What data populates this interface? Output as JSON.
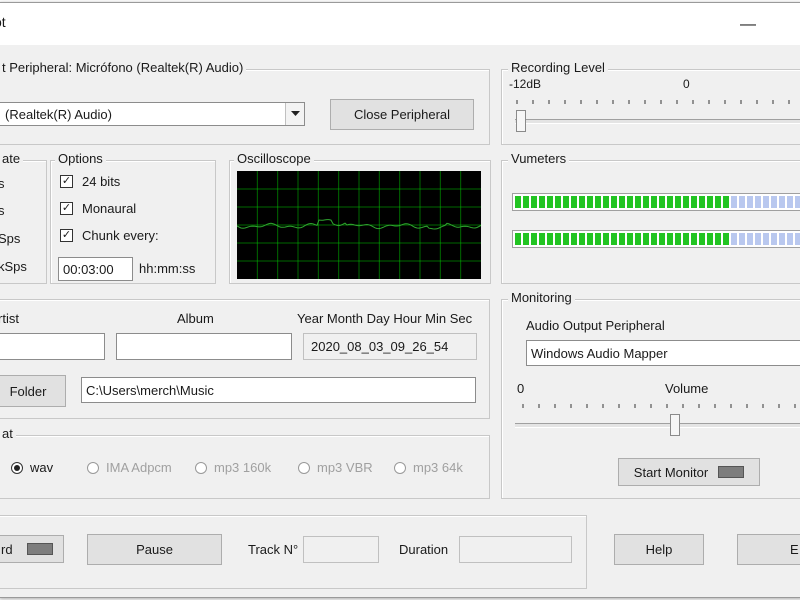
{
  "window": {
    "title_fragment": "ot",
    "minimize_glyph": "—"
  },
  "input_group": {
    "label": "t Peripheral: Micrófono (Realtek(R) Audio)",
    "device_value": "(Realtek(R) Audio)",
    "close_button": "Close Peripheral"
  },
  "rate_group": {
    "label": "ate",
    "items": [
      "s",
      "s",
      "Sps",
      "kSps"
    ]
  },
  "options_group": {
    "label": "Options",
    "bits24": {
      "label": "24 bits",
      "checked": true
    },
    "monaural": {
      "label": "Monaural",
      "checked": true
    },
    "chunk": {
      "label": "Chunk every:",
      "checked": true
    },
    "chunk_value": "00:03:00",
    "chunk_unit": "hh:mm:ss"
  },
  "oscilloscope": {
    "label": "Oscilloscope",
    "grid_color": "#00c000",
    "trace_color": "#2fa52f"
  },
  "tags": {
    "artist_label": "rtist",
    "artist_value": "",
    "album_label": "Album",
    "album_value": "",
    "date_label": "Year Month Day Hour Min Sec",
    "date_value": "2020_08_03_09_26_54"
  },
  "folder": {
    "button": "Folder",
    "path": "C:\\Users\\merch\\Music"
  },
  "format_group": {
    "label": "at",
    "options": [
      {
        "label": "wav",
        "selected": true,
        "enabled": true
      },
      {
        "label": "IMA Adpcm",
        "selected": false,
        "enabled": false
      },
      {
        "label": "mp3 160k",
        "selected": false,
        "enabled": false
      },
      {
        "label": "mp3 VBR",
        "selected": false,
        "enabled": false
      },
      {
        "label": "mp3 64k",
        "selected": false,
        "enabled": false
      }
    ]
  },
  "recording_level": {
    "label": "Recording Level",
    "left_mark": "-12dB",
    "center_mark": "0",
    "level": 0.0
  },
  "vumeters": {
    "label": "Vumeters",
    "channels": [
      {
        "level": 0.72
      },
      {
        "level": 0.72
      }
    ],
    "on_color": "#22c422",
    "off_color": "#b9c8ef"
  },
  "monitoring": {
    "label": "Monitoring",
    "output_label": "Audio Output Peripheral",
    "output_value": "Windows Audio Mapper",
    "min_mark": "0",
    "volume_label": "Volume",
    "volume": 0.55,
    "start_button": "Start Monitor"
  },
  "transport": {
    "record_button": "rd",
    "pause_button": "Pause",
    "track_label": "Track N°",
    "track_value": "",
    "duration_label": "Duration",
    "duration_value": "",
    "help_button": "Help",
    "exit_button": "E"
  }
}
